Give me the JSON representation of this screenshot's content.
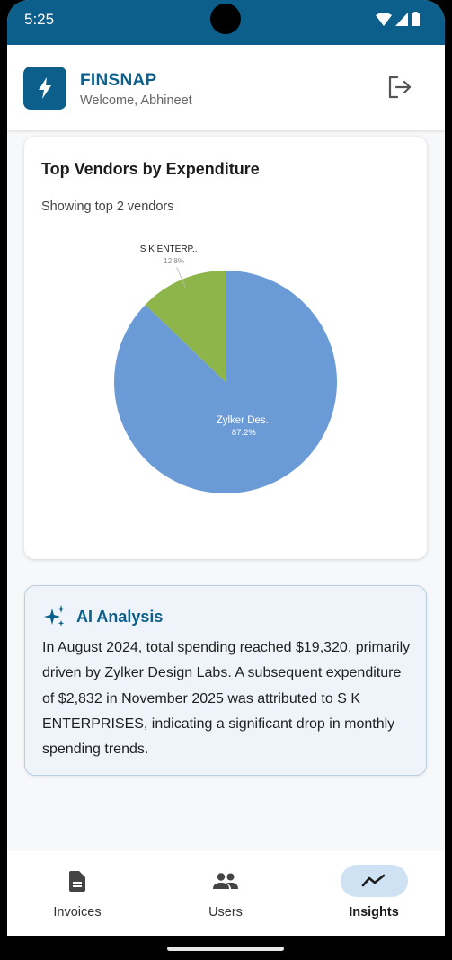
{
  "status": {
    "time": "5:25"
  },
  "header": {
    "logo_icon": "bolt-icon",
    "title": "FINSNAP",
    "subtitle": "Welcome, Abhineet",
    "logout_icon": "logout-icon"
  },
  "vendors": {
    "title": "Top Vendors by Expenditure",
    "subtitle": "Showing top 2 vendors"
  },
  "chart_data": {
    "type": "pie",
    "slices": [
      {
        "label": "Zylker Des..",
        "percent_label": "87.2%",
        "value": 87.2,
        "color": "#6b9bd6"
      },
      {
        "label": "S K ENTERP..",
        "percent_label": "12.8%",
        "value": 12.8,
        "color": "#8db54a"
      }
    ]
  },
  "ai": {
    "icon": "sparkle-icon",
    "title": "AI Analysis",
    "text": "In August 2024, total spending reached $19,320, primarily driven by Zylker Design Labs. A subsequent expenditure of $2,832 in November 2025 was attributed to S K ENTERPRISES, indicating a significant drop in monthly spending trends."
  },
  "nav": {
    "items": [
      {
        "label": "Invoices",
        "icon": "document-icon",
        "active": false
      },
      {
        "label": "Users",
        "icon": "users-icon",
        "active": false
      },
      {
        "label": "Insights",
        "icon": "trend-icon",
        "active": true
      }
    ]
  },
  "colors": {
    "primary": "#0b5f8a",
    "pie_blue": "#6b9bd6",
    "pie_green": "#8db54a"
  }
}
